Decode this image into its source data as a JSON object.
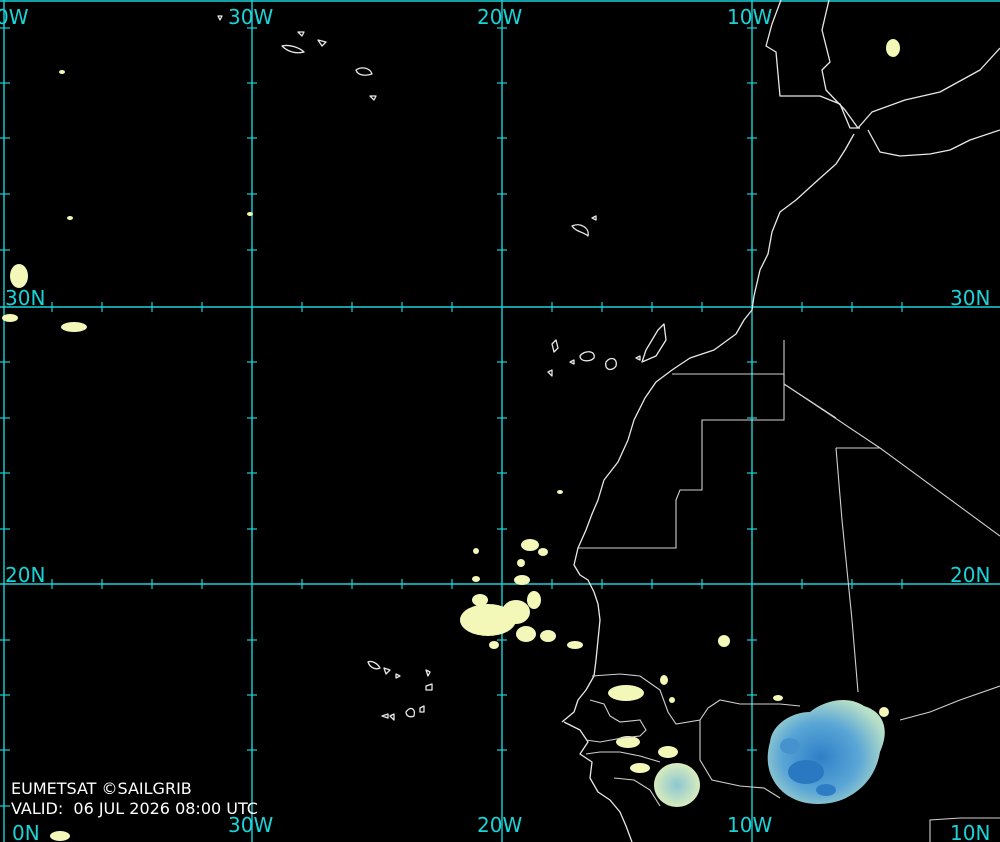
{
  "map": {
    "grid_color": "#19d3d8",
    "coast_color": "#e8e8e8",
    "cloud_light_color": "#f3f7b8",
    "cloud_deep_color": "#3d8fd0",
    "longitudes": {
      "w40": "0W",
      "w30": "30W",
      "w20": "20W",
      "w10": "10W",
      "bottom_left": "0N"
    },
    "latitudes": {
      "n30": "30N",
      "n20": "20N",
      "n10": "10N"
    }
  },
  "credit": {
    "line1": "EUMETSAT ©SAILGRIB",
    "line2": "VALID:  06 JUL 2026 08:00 UTC"
  }
}
